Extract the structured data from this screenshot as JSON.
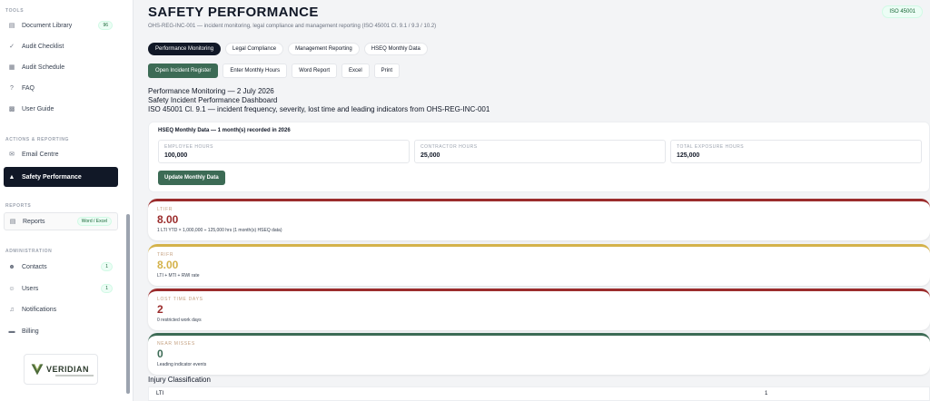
{
  "sidebar": {
    "sections": {
      "tools": "TOOLS",
      "actions": "ACTIONS & REPORTING",
      "reports": "REPORTS",
      "administration": "ADMINISTRATION"
    },
    "items": {
      "document_library": {
        "label": "Document Library",
        "badge": "96"
      },
      "audit_checklist": {
        "label": "Audit Checklist"
      },
      "audit_schedule": {
        "label": "Audit Schedule"
      },
      "faq": {
        "label": "FAQ"
      },
      "user_guide": {
        "label": "User Guide"
      },
      "email_centre": {
        "label": "Email Centre"
      },
      "safety_performance": {
        "label": "Safety Performance"
      },
      "reports": {
        "label": "Reports",
        "badge": "Word / Excel"
      },
      "contacts": {
        "label": "Contacts",
        "badge": "1"
      },
      "users": {
        "label": "Users",
        "badge": "1"
      },
      "notifications": {
        "label": "Notifications"
      },
      "billing": {
        "label": "Billing"
      }
    },
    "logo_text": "VERIDIAN"
  },
  "header": {
    "title": "SAFETY PERFORMANCE",
    "subtitle": "OHS-REG-INC-001 — incident monitoring, legal compliance and management reporting (ISO 45001 Cl. 9.1 / 9.3 / 10.2)",
    "badge": "ISO 45001"
  },
  "tabs": [
    "Performance Monitoring",
    "Legal Compliance",
    "Management Reporting",
    "HSEQ Monthly Data"
  ],
  "actions": [
    "Open Incident Register",
    "Enter Monthly Hours",
    "Word Report",
    "Excel",
    "Print"
  ],
  "report": {
    "line1": "Performance Monitoring — 2 July 2026",
    "line2": "Safety Incident Performance Dashboard",
    "line3": "ISO 45001 Cl. 9.1 — incident frequency, severity, lost time and leading indicators from OHS-REG-INC-001"
  },
  "hseq": {
    "title": "HSEQ Monthly Data — 1 month(s) recorded in 2026",
    "employee": {
      "label": "EMPLOYEE HOURS",
      "value": "100,000"
    },
    "contractor": {
      "label": "CONTRACTOR HOURS",
      "value": "25,000"
    },
    "total": {
      "label": "TOTAL EXPOSURE HOURS",
      "value": "125,000"
    },
    "button": "Update Monthly Data"
  },
  "kpis": [
    {
      "label": "LTIFR",
      "value": "8.00",
      "note": "1 LTI YTD × 1,000,000 ÷ 125,000 hrs (1 month(s) HSEQ data)",
      "color": "#9b2c2c",
      "value_color": "#9b2c2c"
    },
    {
      "label": "TRIFR",
      "value": "8.00",
      "note": "LTI + MTI + RWI rate",
      "color": "#d4b24a",
      "value_color": "#d4b24a"
    },
    {
      "label": "LOST TIME DAYS",
      "value": "2",
      "note": "0 restricted work days",
      "color": "#9b2c2c",
      "value_color": "#9b2c2c"
    },
    {
      "label": "NEAR MISSES",
      "value": "0",
      "note": "Leading indicator events",
      "color": "#3c6b55",
      "value_color": "#3c6b55"
    }
  ],
  "injury": {
    "title": "Injury Classification",
    "rows": [
      {
        "label": "LTI",
        "value": "1"
      }
    ]
  }
}
